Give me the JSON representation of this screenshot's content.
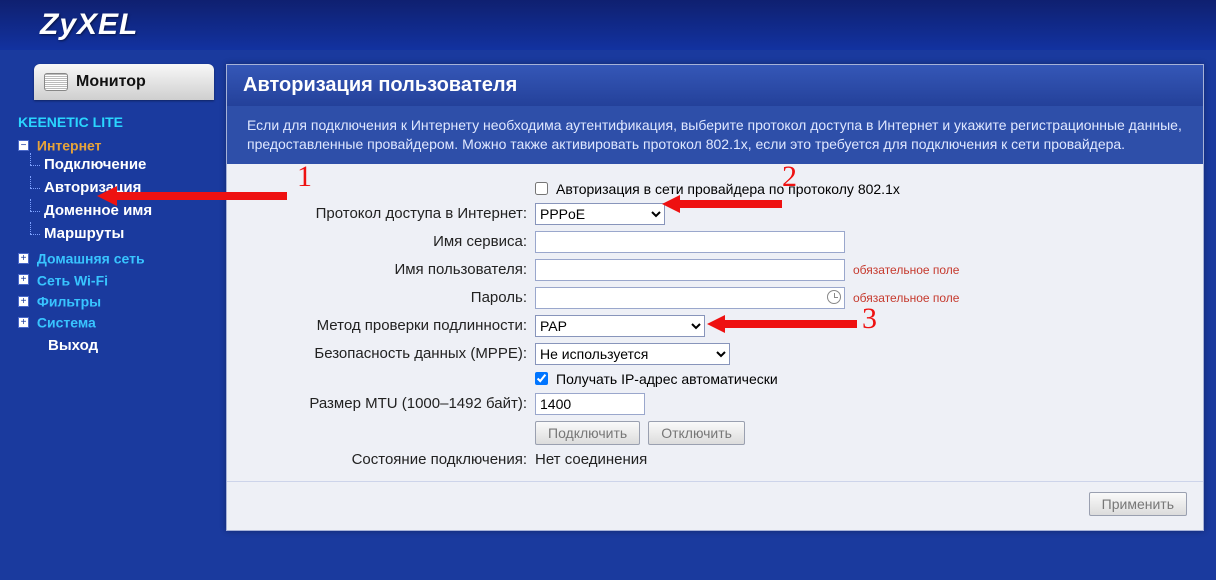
{
  "brand": "ZyXEL",
  "monitor_label": "Монитор",
  "device_title": "KEENETIC LITE",
  "nav": {
    "internet": {
      "label": "Интернет",
      "expanded": true,
      "children": [
        "Подключение",
        "Авторизация",
        "Доменное имя",
        "Маршруты"
      ]
    },
    "homenet": {
      "label": "Домашняя сеть"
    },
    "wifi": {
      "label": "Сеть Wi-Fi"
    },
    "filters": {
      "label": "Фильтры"
    },
    "system": {
      "label": "Система"
    },
    "exit": {
      "label": "Выход"
    }
  },
  "panel": {
    "title": "Авторизация пользователя",
    "description": "Если для подключения к Интернету необходима аутентификация, выберите протокол доступа в Интернет и укажите регистрационные данные, предоставленные провайдером. Можно также активировать протокол 802.1x, если это требуется для подключения к сети провайдера."
  },
  "form": {
    "chk_8021x_label": "Авторизация в сети провайдера по протоколу 802.1x",
    "chk_8021x_checked": false,
    "protocol_label": "Протокол доступа в Интернет:",
    "protocol_value": "PPPoE",
    "service_label": "Имя сервиса:",
    "service_value": "",
    "user_label": "Имя пользователя:",
    "user_value": "",
    "required_hint": "обязательное поле",
    "password_label": "Пароль:",
    "password_value": "",
    "auth_method_label": "Метод проверки подлинности:",
    "auth_method_value": "PAP",
    "mppe_label": "Безопасность данных (MPPE):",
    "mppe_value": "Не используется",
    "autoip_label": "Получать IP-адрес автоматически",
    "autoip_checked": true,
    "mtu_label": "Размер MTU (1000–1492 байт):",
    "mtu_value": "1400",
    "connect_btn": "Подключить",
    "disconnect_btn": "Отключить",
    "status_label": "Состояние подключения:",
    "status_value": "Нет соединения",
    "apply_btn": "Применить"
  },
  "annotations": {
    "n1": "1",
    "n2": "2",
    "n3": "3"
  },
  "colors": {
    "accent": "#1a3a9e",
    "link": "#38c4ff",
    "warn": "#c63a2e"
  }
}
